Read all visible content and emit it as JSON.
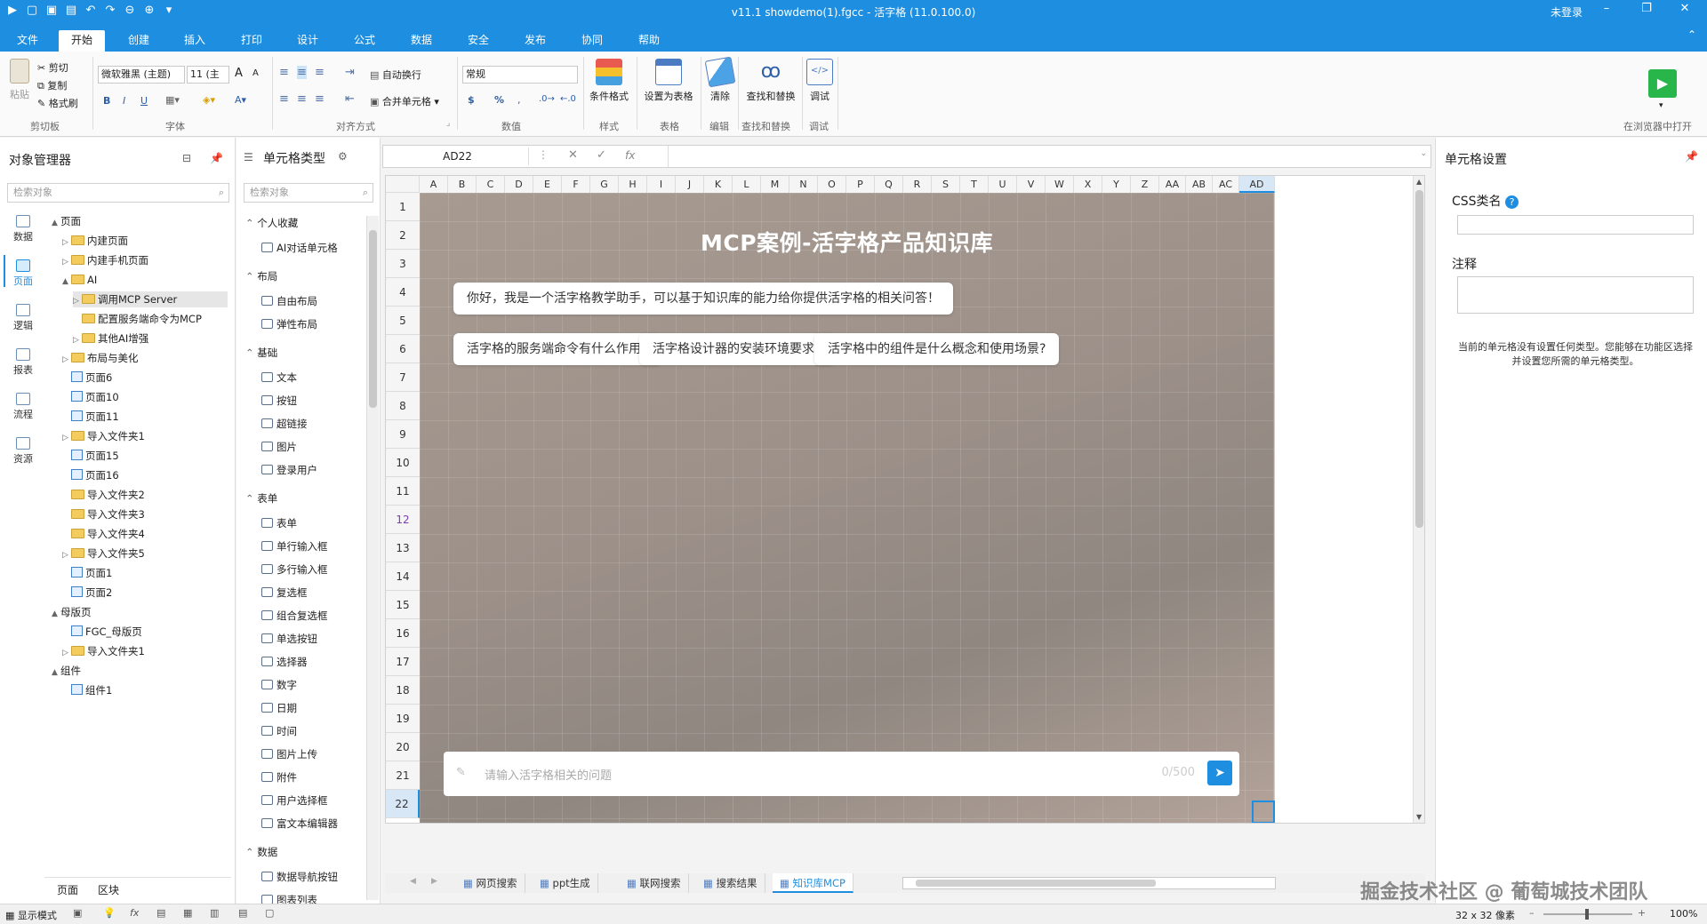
{
  "window": {
    "title": "v11.1 showdemo(1).fgcc - 活字格 (11.0.100.0)",
    "login": "未登录"
  },
  "menu_tabs": [
    "文件",
    "开始",
    "创建",
    "插入",
    "打印",
    "设计",
    "公式",
    "数据",
    "安全",
    "发布",
    "协同",
    "帮助"
  ],
  "active_menu_tab": "开始",
  "ribbon": {
    "clipboard": {
      "paste": "粘贴",
      "cut": "剪切",
      "copy": "复制",
      "format_painter": "格式刷",
      "label": "剪切板"
    },
    "font": {
      "family": "微软雅黑 (主题)",
      "size": "11 (主",
      "label": "字体",
      "bold": "B",
      "italic": "I",
      "underline": "U",
      "grow": "A",
      "shrink": "A"
    },
    "align": {
      "wrap": "自动换行",
      "merge": "合并单元格",
      "label": "对齐方式"
    },
    "number": {
      "format": "常规",
      "currency": "$",
      "percent": "%",
      "label": "数值"
    },
    "style": {
      "conditional": "条件格式",
      "label": "样式"
    },
    "table": {
      "set_table": "设置为表格",
      "label": "表格"
    },
    "edit": {
      "clear": "清除",
      "label": "编辑"
    },
    "find": {
      "find_replace": "查找和替换",
      "label": "查找和替换"
    },
    "debug": {
      "debug": "调试",
      "label": "调试"
    },
    "run_label": "在浏览器中打开"
  },
  "left_panel": {
    "title": "对象管理器",
    "search_placeholder": "检索对象",
    "nav": [
      "数据",
      "页面",
      "逻辑",
      "报表",
      "流程",
      "资源"
    ],
    "active_nav": "页面",
    "tree": [
      {
        "label": "页面",
        "level": 0,
        "type": "root",
        "arrow": "▲"
      },
      {
        "label": "内建页面",
        "level": 1,
        "type": "folder",
        "arrow": "▷"
      },
      {
        "label": "内建手机页面",
        "level": 1,
        "type": "folder",
        "arrow": "▷"
      },
      {
        "label": "AI",
        "level": 1,
        "type": "folder",
        "arrow": "▲"
      },
      {
        "label": "调用MCP Server",
        "level": 2,
        "type": "folder",
        "arrow": "▷",
        "selected": true
      },
      {
        "label": "配置服务端命令为MCP",
        "level": 2,
        "type": "folder",
        "arrow": ""
      },
      {
        "label": "其他AI增强",
        "level": 2,
        "type": "folder",
        "arrow": "▷"
      },
      {
        "label": "布局与美化",
        "level": 1,
        "type": "folder",
        "arrow": "▷"
      },
      {
        "label": "页面6",
        "level": 1,
        "type": "page",
        "arrow": ""
      },
      {
        "label": "页面10",
        "level": 1,
        "type": "page",
        "arrow": ""
      },
      {
        "label": "页面11",
        "level": 1,
        "type": "page",
        "arrow": ""
      },
      {
        "label": "导入文件夹1",
        "level": 1,
        "type": "folder",
        "arrow": "▷"
      },
      {
        "label": "页面15",
        "level": 1,
        "type": "page",
        "arrow": ""
      },
      {
        "label": "页面16",
        "level": 1,
        "type": "page",
        "arrow": ""
      },
      {
        "label": "导入文件夹2",
        "level": 1,
        "type": "folder",
        "arrow": ""
      },
      {
        "label": "导入文件夹3",
        "level": 1,
        "type": "folder",
        "arrow": ""
      },
      {
        "label": "导入文件夹4",
        "level": 1,
        "type": "folder",
        "arrow": ""
      },
      {
        "label": "导入文件夹5",
        "level": 1,
        "type": "folder",
        "arrow": "▷"
      },
      {
        "label": "页面1",
        "level": 1,
        "type": "page",
        "arrow": ""
      },
      {
        "label": "页面2",
        "level": 1,
        "type": "page",
        "arrow": ""
      },
      {
        "label": "母版页",
        "level": 0,
        "type": "root",
        "arrow": "▲"
      },
      {
        "label": "FGC_母版页",
        "level": 1,
        "type": "page",
        "arrow": ""
      },
      {
        "label": "导入文件夹1",
        "level": 1,
        "type": "folder",
        "arrow": "▷"
      },
      {
        "label": "组件",
        "level": 0,
        "type": "root",
        "arrow": "▲"
      },
      {
        "label": "组件1",
        "level": 1,
        "type": "page",
        "arrow": ""
      }
    ],
    "bottom_tabs": [
      "页面",
      "区块"
    ]
  },
  "cell_panel": {
    "title": "单元格类型",
    "search_placeholder": "检索对象",
    "groups": [
      {
        "name": "个人收藏",
        "items": [
          "AI对话单元格"
        ]
      },
      {
        "name": "布局",
        "items": [
          "自由布局",
          "弹性布局"
        ]
      },
      {
        "name": "基础",
        "items": [
          "文本",
          "按钮",
          "超链接",
          "图片",
          "登录用户"
        ]
      },
      {
        "name": "表单",
        "items": [
          "表单",
          "单行输入框",
          "多行输入框",
          "复选框",
          "组合复选框",
          "单选按钮",
          "选择器",
          "数字",
          "日期",
          "时间",
          "图片上传",
          "附件",
          "用户选择框",
          "富文本编辑器"
        ]
      },
      {
        "name": "数据",
        "items": [
          "数据导航按钮",
          "图表列表"
        ]
      }
    ]
  },
  "formula_bar": {
    "cell_ref": "AD22",
    "fx": "fx",
    "value": ""
  },
  "grid": {
    "columns": [
      "A",
      "B",
      "C",
      "D",
      "E",
      "F",
      "G",
      "H",
      "I",
      "J",
      "K",
      "L",
      "M",
      "N",
      "O",
      "P",
      "Q",
      "R",
      "S",
      "T",
      "U",
      "V",
      "W",
      "X",
      "Y",
      "Z",
      "AA",
      "AB",
      "AC",
      "AD"
    ],
    "rows": [
      "1",
      "2",
      "3",
      "4",
      "5",
      "6",
      "7",
      "8",
      "9",
      "10",
      "11",
      "12",
      "13",
      "14",
      "15",
      "16",
      "17",
      "18",
      "19",
      "20",
      "21",
      "22"
    ],
    "highlight_row": "12",
    "active_col": "AD",
    "active_row": "22"
  },
  "app": {
    "title": "MCP案例-活字格产品知识库",
    "greeting": "你好，我是一个活字格教学助手，可以基于知识库的能力给你提供活字格的相关问答！",
    "suggestions": [
      "活字格的服务端命令有什么作用?",
      "活字格设计器的安装环境要求?",
      "活字格中的组件是什么概念和使用场景?"
    ],
    "input_placeholder": "请输入活字格相关的问题",
    "counter": "0/500"
  },
  "sheet_tabs": [
    "网页搜索",
    "ppt生成",
    "联网搜索",
    "搜索结果",
    "知识库MCP"
  ],
  "active_sheet": "知识库MCP",
  "right_panel": {
    "title": "单元格设置",
    "css_label": "CSS类名",
    "note_label": "注释",
    "message": "当前的单元格没有设置任何类型。您能够在功能区选择并设置您所需的单元格类型。"
  },
  "status": {
    "mode": "显示模式",
    "size": "32 x 32 像素",
    "zoom": "100%",
    "watermark": "掘金技术社区 @ 葡萄城技术团队"
  },
  "colors": {
    "accent": "#1e8ee0",
    "send": "#1e8ee0"
  }
}
